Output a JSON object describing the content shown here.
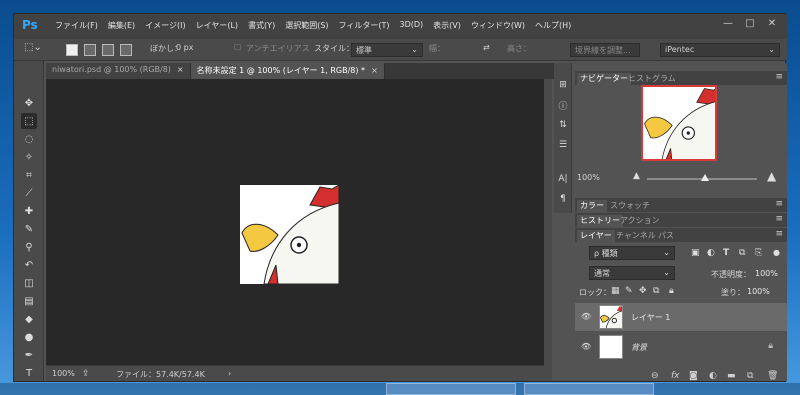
{
  "app": {
    "logo": "Ps"
  },
  "menu": [
    "ファイル(F)",
    "編集(E)",
    "イメージ(I)",
    "レイヤー(L)",
    "書式(Y)",
    "選択範囲(S)",
    "フィルター(T)",
    "3D(D)",
    "表示(V)",
    "ウィンドウ(W)",
    "ヘルプ(H)"
  ],
  "window_controls": {
    "minimize": "—",
    "maximize": "□",
    "close": "✕"
  },
  "options": {
    "feather_label": "ぼかし：",
    "feather_value": "0 px",
    "antialias_label": "アンチエイリアス",
    "style_label": "スタイル：",
    "style_value": "標準",
    "width_label": "幅：",
    "height_label": "高さ：",
    "refine_edge": "境界線を調整...",
    "workspace": "iPentec"
  },
  "tabs": [
    {
      "label": "niwatori.psd @ 100% (RGB/8)",
      "close": "×"
    },
    {
      "label": "名称未設定 1 @ 100% (レイヤー 1, RGB/8) *",
      "close": "×"
    }
  ],
  "status": {
    "zoom": "100%",
    "file_info": "ファイル：57.4K/57.4K",
    "arrow": "›"
  },
  "navigator": {
    "tabs": [
      "ナビゲーター",
      "ヒストグラム"
    ],
    "zoom": "100%"
  },
  "color_panel": {
    "tabs": [
      "カラー",
      "スウォッチ"
    ]
  },
  "history_panel": {
    "tabs": [
      "ヒストリー",
      "アクション"
    ]
  },
  "layers_panel": {
    "tabs": [
      "レイヤー",
      "チャンネル",
      "パス"
    ],
    "filter": "ρ 種類",
    "blend_mode": "通常",
    "opacity_label": "不透明度：",
    "opacity_value": "100%",
    "lock_label": "ロック：",
    "fill_label": "塗り：",
    "fill_value": "100%",
    "layers": [
      {
        "name": "レイヤー 1",
        "selected": true
      },
      {
        "name": "背景",
        "selected": false
      }
    ],
    "footer_icons": [
      "link-icon",
      "fx-icon",
      "mask-icon",
      "adjustment-icon",
      "folder-icon",
      "new-layer-icon",
      "trash-icon"
    ]
  },
  "colors": {
    "chrome_dark": "#424242",
    "chrome_mid": "#535353",
    "canvas_bg": "#282828",
    "accent_ps": "#31a8ff",
    "nav_frame": "#d83a3a",
    "chicken_red": "#d32f2f",
    "beak_yellow": "#f5c842"
  }
}
